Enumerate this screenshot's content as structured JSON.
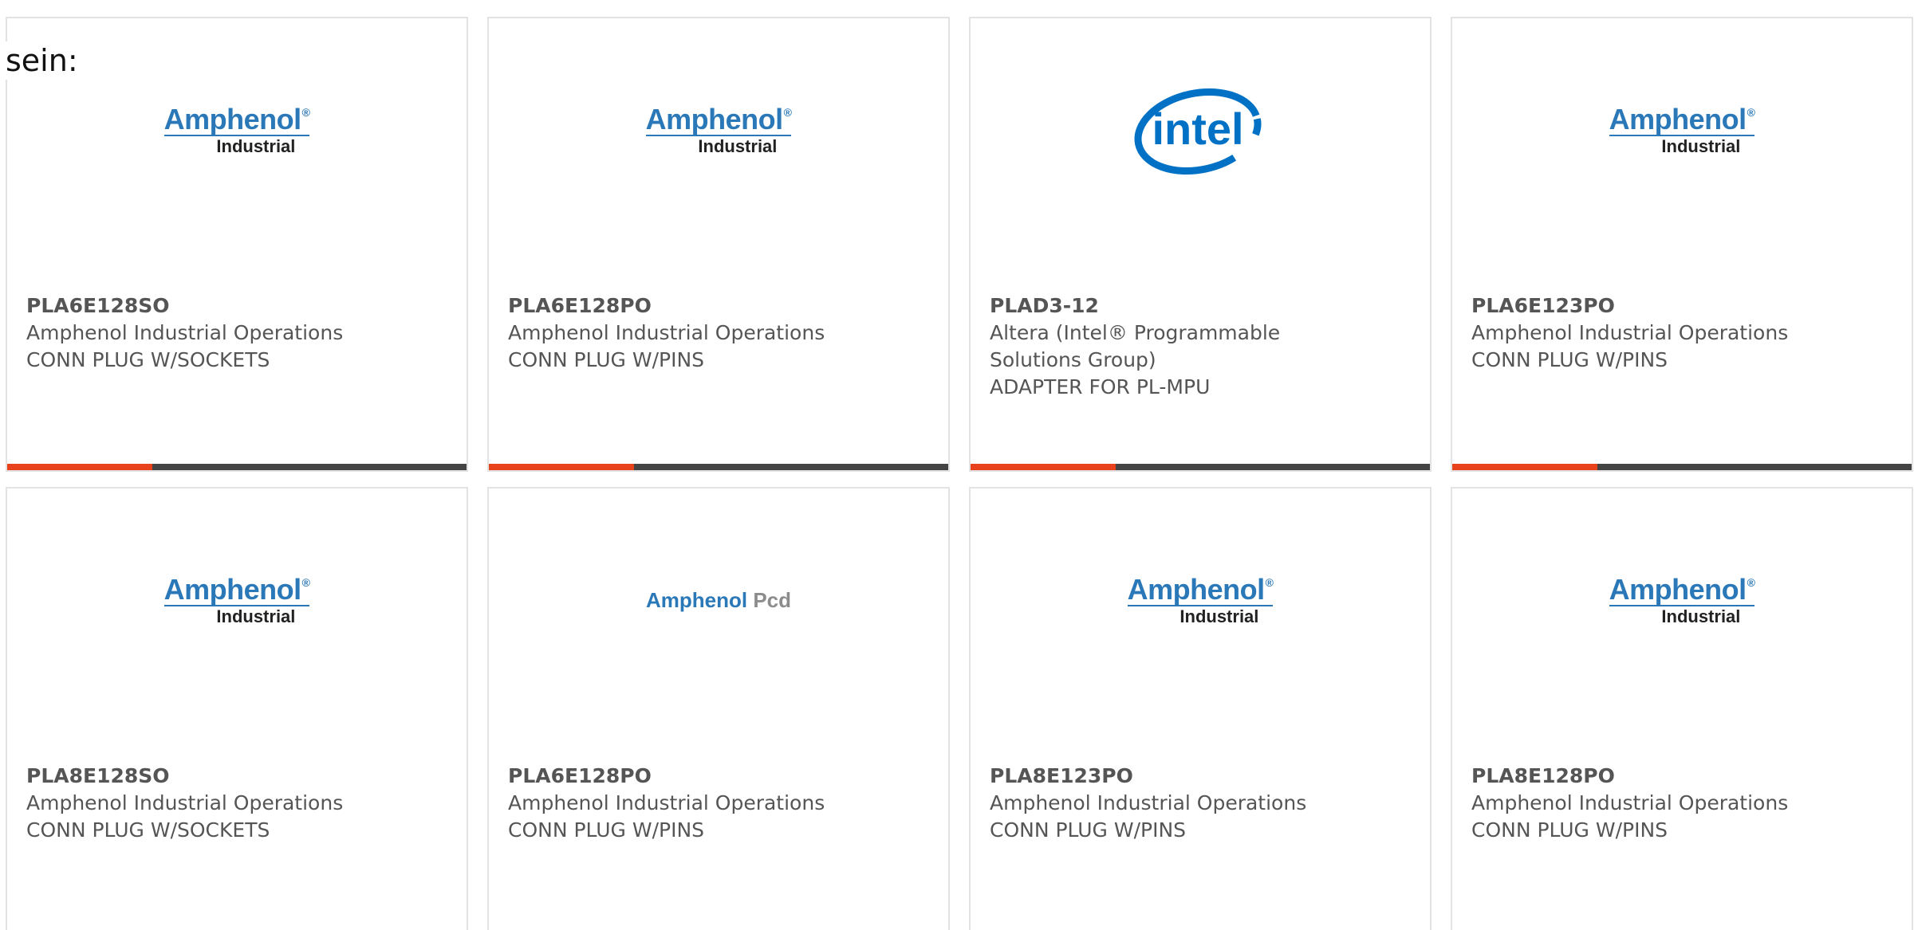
{
  "intro": {
    "text": "sein:"
  },
  "colors": {
    "accent": "#e8421c",
    "bar": "#444444",
    "amphenol_blue": "#2a78b8",
    "intel_blue": "#0071c5",
    "text": "#555555"
  },
  "products": [
    {
      "part_number": "PLA6E128SO",
      "manufacturer": "Amphenol Industrial Operations",
      "description": "CONN PLUG W/SOCKETS",
      "logo": {
        "type": "amphenol-industrial",
        "brand": "Amphenol",
        "mark": "®",
        "sub": "Industrial"
      }
    },
    {
      "part_number": "PLA6E128PO",
      "manufacturer": "Amphenol Industrial Operations",
      "description": "CONN PLUG W/PINS",
      "logo": {
        "type": "amphenol-industrial",
        "brand": "Amphenol",
        "mark": "®",
        "sub": "Industrial"
      }
    },
    {
      "part_number": "PLAD3-12",
      "manufacturer": "Altera (Intel® Programmable Solutions Group)",
      "description": "ADAPTER FOR PL-MPU",
      "logo": {
        "type": "intel",
        "brand": "intel"
      }
    },
    {
      "part_number": "PLA6E123PO",
      "manufacturer": "Amphenol Industrial Operations",
      "description": "CONN PLUG W/PINS",
      "logo": {
        "type": "amphenol-industrial",
        "brand": "Amphenol",
        "mark": "®",
        "sub": "Industrial"
      }
    },
    {
      "part_number": "PLA8E128SO",
      "manufacturer": "Amphenol Industrial Operations",
      "description": "CONN PLUG W/SOCKETS",
      "logo": {
        "type": "amphenol-industrial",
        "brand": "Amphenol",
        "mark": "®",
        "sub": "Industrial"
      }
    },
    {
      "part_number": "PLA6E128PO",
      "manufacturer": "Amphenol Industrial Operations",
      "description": "CONN PLUG W/PINS",
      "logo": {
        "type": "amphenol-pcd",
        "brand": "Amphenol",
        "sub": "Pcd"
      }
    },
    {
      "part_number": "PLA8E123PO",
      "manufacturer": "Amphenol Industrial Operations",
      "description": "CONN PLUG W/PINS",
      "logo": {
        "type": "amphenol-industrial",
        "brand": "Amphenol",
        "mark": "®",
        "sub": "Industrial"
      }
    },
    {
      "part_number": "PLA8E128PO",
      "manufacturer": "Amphenol Industrial Operations",
      "description": "CONN PLUG W/PINS",
      "logo": {
        "type": "amphenol-industrial",
        "brand": "Amphenol",
        "mark": "®",
        "sub": "Industrial"
      }
    }
  ]
}
